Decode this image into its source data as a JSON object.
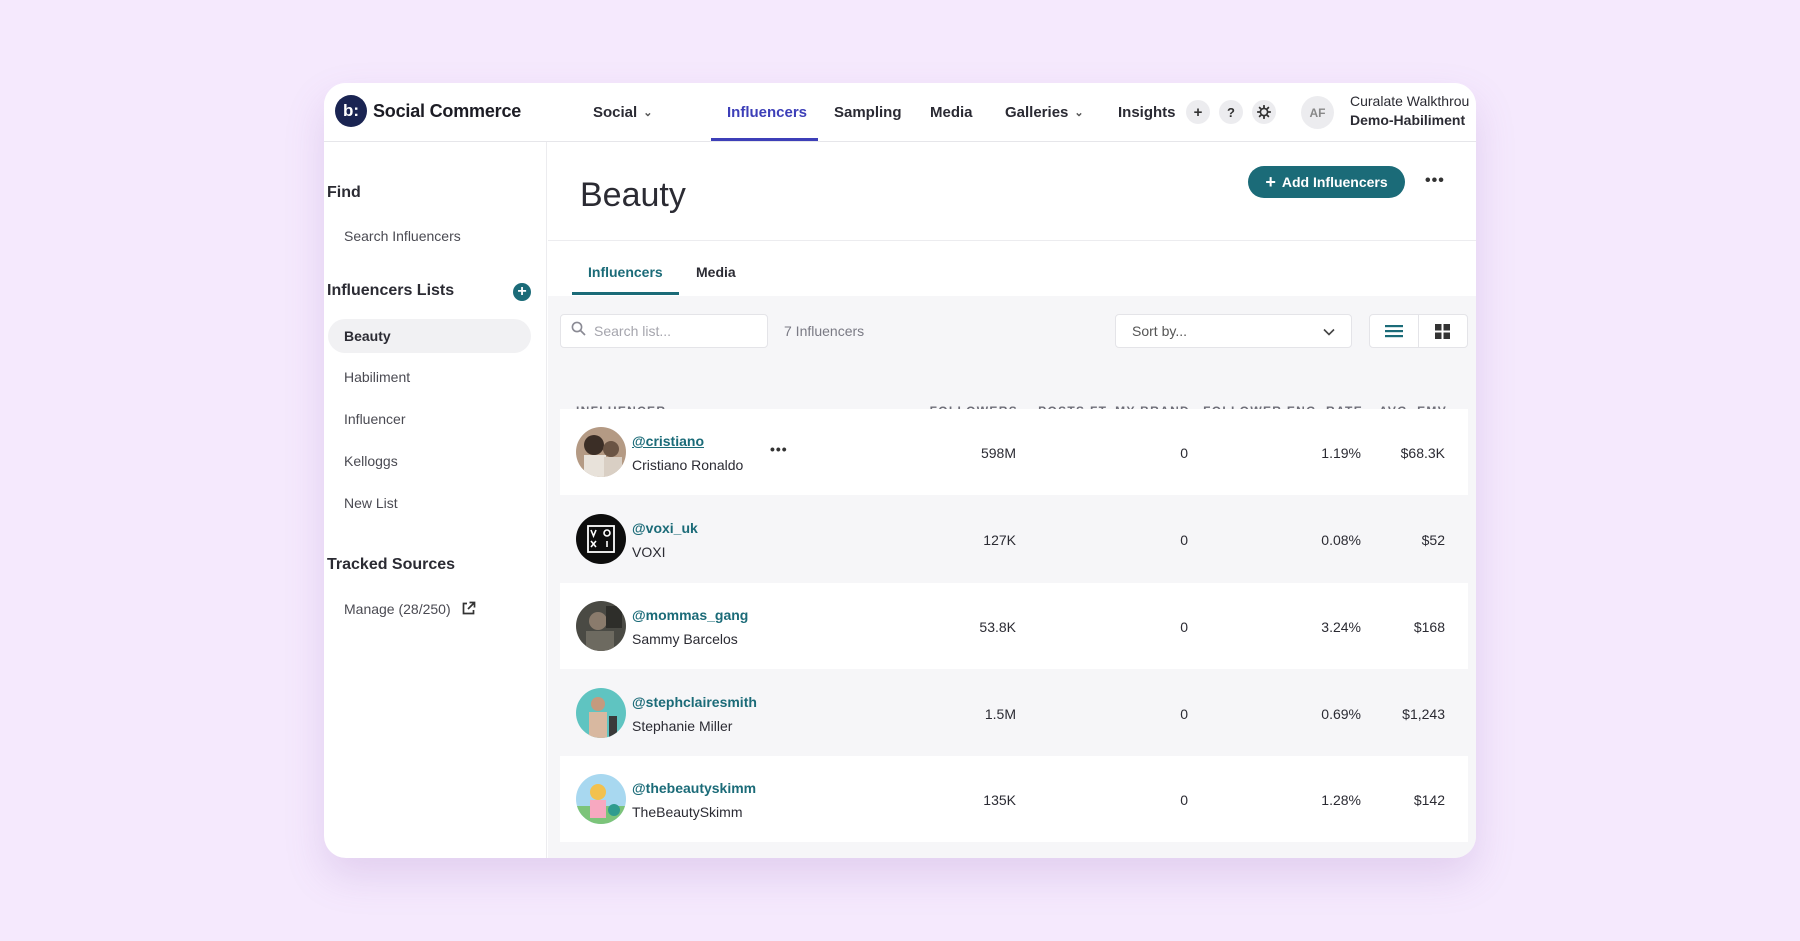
{
  "brand": {
    "logo_text": "b:",
    "name": "Social Commerce"
  },
  "nav": {
    "items": [
      {
        "label": "Social",
        "dropdown": true
      },
      {
        "label": "Influencers",
        "active": true
      },
      {
        "label": "Sampling"
      },
      {
        "label": "Media"
      },
      {
        "label": "Galleries",
        "dropdown": true
      },
      {
        "label": "Insights"
      }
    ],
    "plus_icon": "+",
    "help_icon": "?",
    "avatar_initials": "AF",
    "account_name": "Curalate Walkthrou",
    "account_org": "Demo-Habiliment"
  },
  "sidebar": {
    "find_heading": "Find",
    "search_influencers": "Search Influencers",
    "lists_heading": "Influencers Lists",
    "lists": [
      "Beauty",
      "Habiliment",
      "Influencer",
      "Kelloggs",
      "New List"
    ],
    "selected_list": "Beauty",
    "tracked_heading": "Tracked Sources",
    "manage_label": "Manage (28/250)"
  },
  "main": {
    "title": "Beauty",
    "add_button": "Add Influencers",
    "tabs": [
      "Influencers",
      "Media"
    ],
    "active_tab": "Influencers",
    "search_placeholder": "Search list...",
    "count_label": "7 Influencers",
    "sort_label": "Sort by..."
  },
  "table": {
    "headers": {
      "influencer": "INFLUENCER",
      "followers": "FOLLOWERS",
      "posts": "POSTS FT. MY BRAND",
      "eng_rate": "FOLLOWER ENG. RATE",
      "emv": "AVG. EMV"
    },
    "rows": [
      {
        "handle": "@cristiano",
        "name": "Cristiano Ronaldo",
        "followers": "598M",
        "posts": "0",
        "eng_rate": "1.19%",
        "emv": "$68.3K"
      },
      {
        "handle": "@voxi_uk",
        "name": "VOXI",
        "followers": "127K",
        "posts": "0",
        "eng_rate": "0.08%",
        "emv": "$52"
      },
      {
        "handle": "@mommas_gang",
        "name": "Sammy Barcelos",
        "followers": "53.8K",
        "posts": "0",
        "eng_rate": "3.24%",
        "emv": "$168"
      },
      {
        "handle": "@stephclairesmith",
        "name": "Stephanie Miller",
        "followers": "1.5M",
        "posts": "0",
        "eng_rate": "0.69%",
        "emv": "$1,243"
      },
      {
        "handle": "@thebeautyskimm",
        "name": "TheBeautySkimm",
        "followers": "135K",
        "posts": "0",
        "eng_rate": "1.28%",
        "emv": "$142"
      }
    ]
  },
  "colors": {
    "accent_teal": "#1b6b78",
    "nav_active": "#3d3fb8",
    "background": "#f5e9fd"
  }
}
